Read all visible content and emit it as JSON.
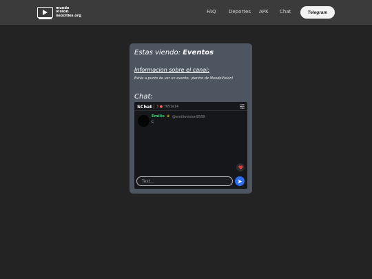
{
  "logo": {
    "line1": "mundo",
    "line2": "vision",
    "line3": "neocities.org"
  },
  "nav": {
    "items": [
      "FAQ",
      "Deportes",
      "APK",
      "Chat"
    ],
    "telegram": "Telegram"
  },
  "card": {
    "title_prefix": "Estas viendo:",
    "title_name": "Eventos",
    "info_title": "Informacion sobre el canal:",
    "info_text": "Estás a punto de ver un evento, ¡dentro de MundoVisión!",
    "chat_title": "Chat:"
  },
  "chat": {
    "brand": "SChat",
    "users": "3",
    "room_id": "f651e14",
    "messages": [
      {
        "user": "Emilio",
        "handle": "@emiliovision9589",
        "text": "c"
      }
    ],
    "input_placeholder": "Text..."
  },
  "colors": {
    "navbar": "#3b3b3b",
    "card": "#4d5561",
    "accent": "#2f6df0",
    "username": "#2ecc71"
  }
}
